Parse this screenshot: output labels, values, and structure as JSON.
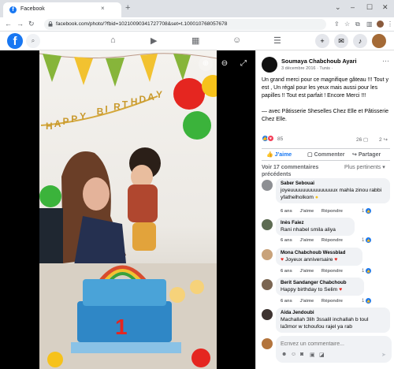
{
  "browser": {
    "tab_title": "Facebook",
    "tab_favicon": "f",
    "url": "facebook.com/photo/?fbid=10210090341727708&set=t.100010768057678",
    "new_tab": "+",
    "close_tab": "×"
  },
  "fbnav": {
    "logo": "f"
  },
  "post": {
    "author": "Soumaya Chabchoub Ayari",
    "date": "3 décembre 2016 · Tunis ·",
    "text": "Un grand merci pour ce magnifique gâteau !!! Tout y est , Un régal pour les yeux mais aussi pour les papilles !! Tout est parfait ! Encore Merci !!!",
    "tag": "— avec Pâtisserie Sheselles Chez Elle et Pâtisserie Chez Elle.",
    "reaction_count": "85",
    "comment_count": "26",
    "share_count": "2",
    "actions": {
      "like": "J'aime",
      "comment": "Commenter",
      "share": "Partager"
    },
    "view_more": "Voir 17 commentaires précédents",
    "sort": "Plus pertinents"
  },
  "comments": [
    {
      "name": "Saber Sebouai",
      "text": "joyeuuuuuuuuuuuuuuux mahla zinou rabbi yfathelholkom",
      "age": "6 ans",
      "like": "J'aime",
      "reply": "Répondre",
      "likes": "1"
    },
    {
      "name": "Inès Faiez",
      "text": "Rani nhabel smila aliya",
      "age": "6 ans",
      "like": "J'aime",
      "reply": "Répondre",
      "likes": "1"
    },
    {
      "name": "Mona Chabchoub Wessblad",
      "text": "Joyeux anniversaire",
      "age": "6 ans",
      "like": "J'aime",
      "reply": "Répondre",
      "likes": "1"
    },
    {
      "name": "Berit Sandanger Chabchoub",
      "text": "Happy birthday to Selim",
      "age": "6 ans",
      "like": "J'aime",
      "reply": "Répondre",
      "likes": "1"
    },
    {
      "name": "Aida Jendoubi",
      "text": "Machallah 3lih 3ssalil inchallah b toul la3mor w tchoufou rajel ya rab",
      "age": "",
      "like": "",
      "reply": "",
      "likes": ""
    }
  ],
  "composer": {
    "placeholder": "Écrivez un commentaire..."
  },
  "photo": {
    "banner_letters": [
      "H",
      "A",
      "P",
      "P",
      "Y",
      " ",
      "B",
      "I",
      "R",
      "T",
      "H",
      "D",
      "A",
      "Y"
    ],
    "cake_number": "1"
  },
  "colors": {
    "fb_blue": "#1877f2",
    "like_red": "#f33e58",
    "balloon_red": "#e52620",
    "balloon_green": "#3bb33b",
    "balloon_yellow": "#f6c21b"
  }
}
